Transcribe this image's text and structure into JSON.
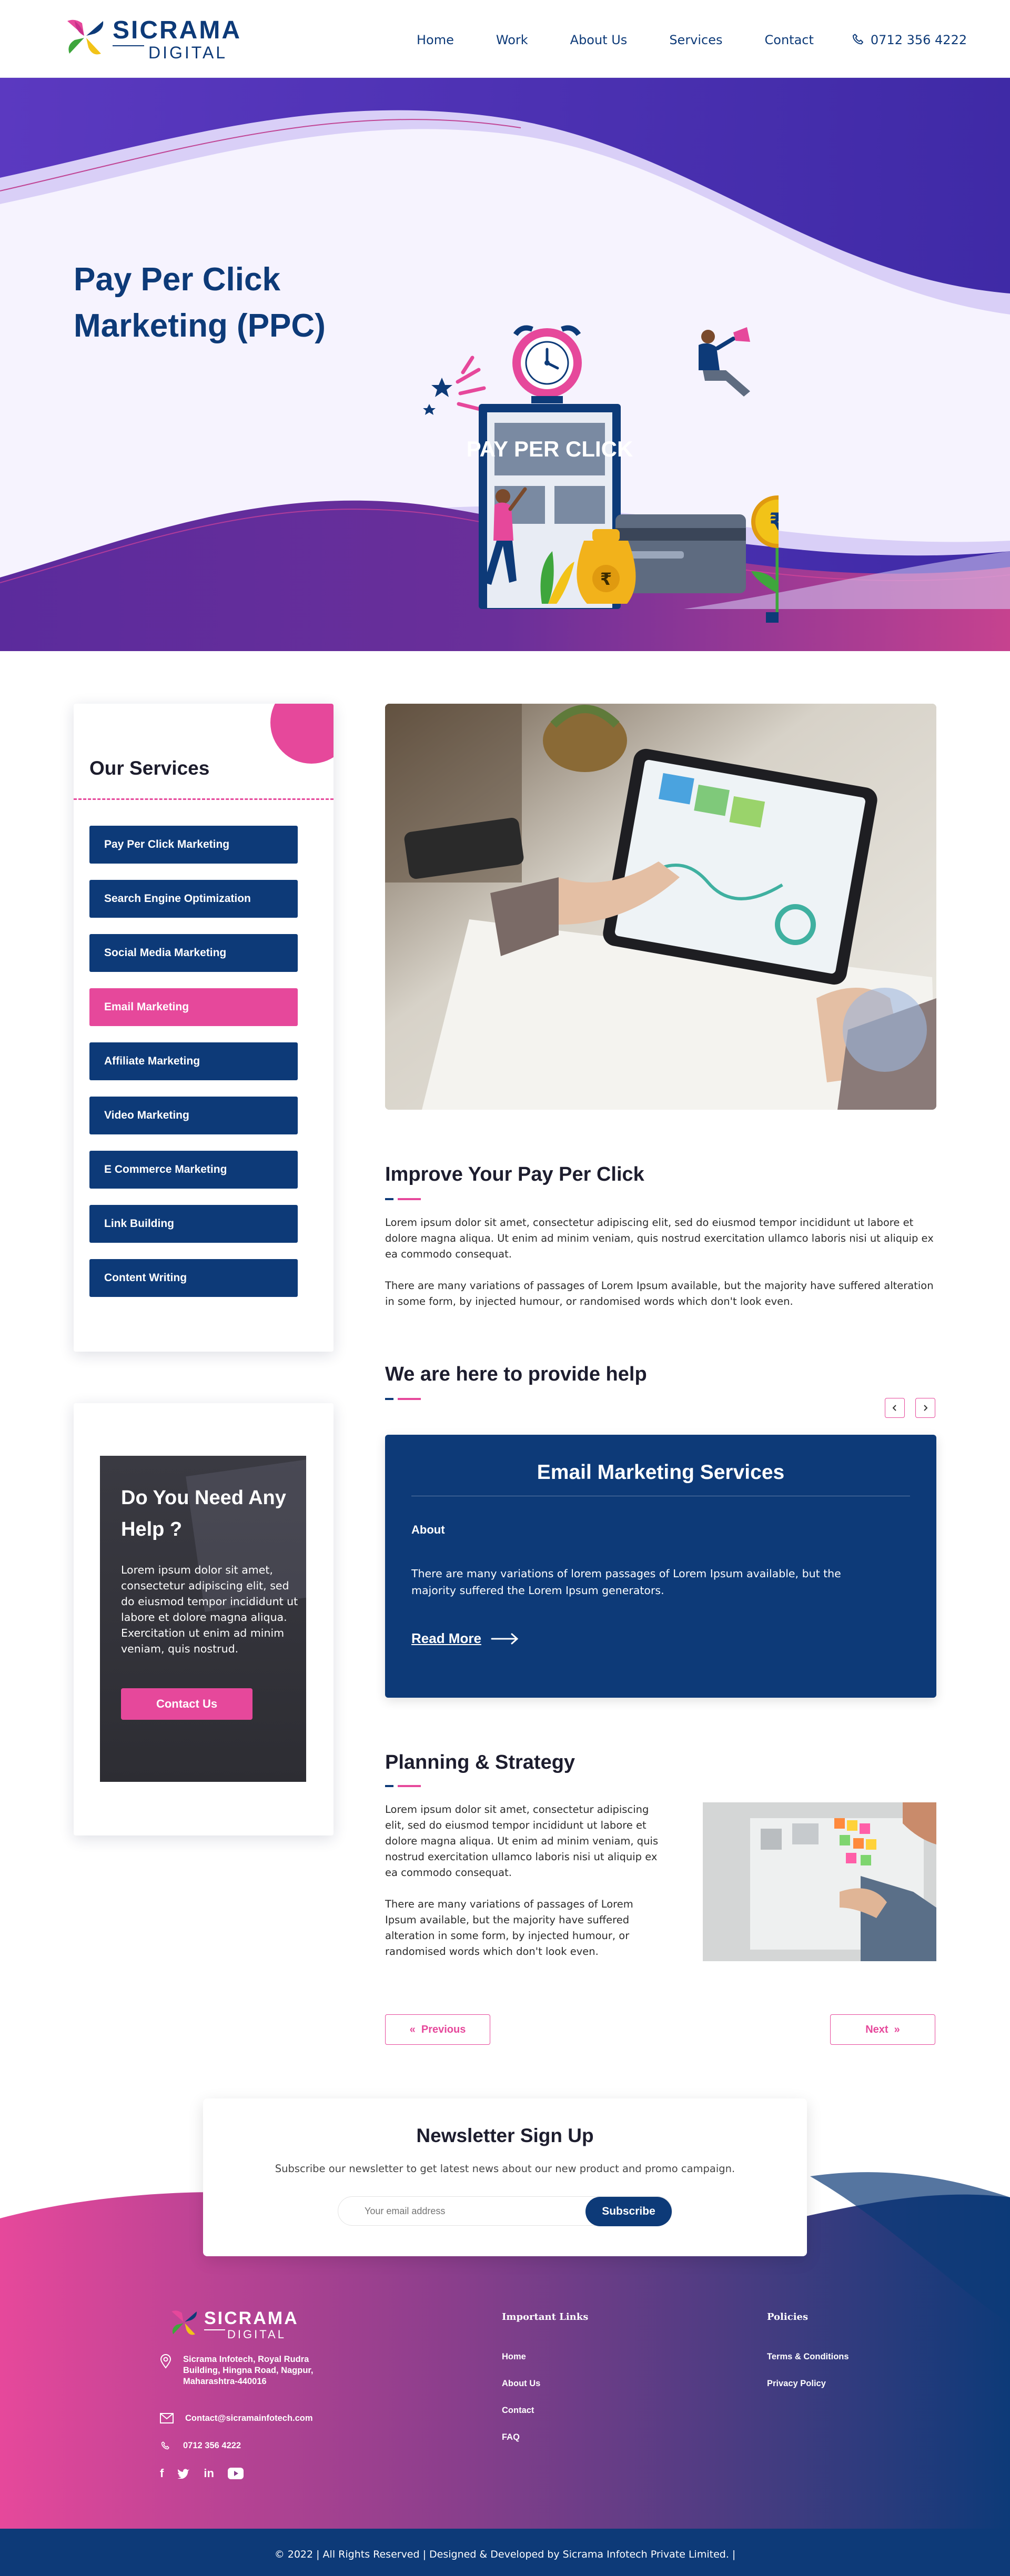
{
  "brand": {
    "name": "SICRAMA",
    "sub": "DIGITAL"
  },
  "nav": {
    "items": [
      {
        "label": "Home"
      },
      {
        "label": "Work"
      },
      {
        "label": "About Us"
      },
      {
        "label": "Services"
      },
      {
        "label": "Contact"
      }
    ],
    "phone": "0712 356 4222"
  },
  "hero": {
    "title": "Pay Per Click Marketing (PPC)",
    "illustration_text": "PAY PER CLICK",
    "currency_symbol": "₹"
  },
  "sidebar": {
    "title": "Our Services",
    "items": [
      {
        "label": "Pay Per Click Marketing",
        "active": false
      },
      {
        "label": "Search Engine Optimization",
        "active": false
      },
      {
        "label": "Social Media Marketing",
        "active": false
      },
      {
        "label": "Email Marketing",
        "active": true
      },
      {
        "label": "Affiliate Marketing",
        "active": false
      },
      {
        "label": "Video Marketing",
        "active": false
      },
      {
        "label": "E Commerce Marketing",
        "active": false
      },
      {
        "label": "Link Building",
        "active": false
      },
      {
        "label": "Content Writing",
        "active": false
      }
    ]
  },
  "help": {
    "title": "Do You Need Any Help ?",
    "text": "Lorem ipsum dolor sit amet, consectetur adipiscing elit, sed do eiusmod tempor incididunt ut labore et dolore magna aliqua. Exercitation ut enim ad minim veniam, quis nostrud.",
    "button": "Contact Us"
  },
  "improve": {
    "title": "Improve Your Pay Per Click",
    "p1": "Lorem ipsum dolor sit amet, consectetur adipiscing elit, sed do eiusmod tempor incididunt ut labore et dolore magna aliqua. Ut enim ad minim veniam, quis nostrud exercitation ullamco laboris nisi ut aliquip ex ea commodo consequat.",
    "p2": "There are many variations of passages of Lorem Ipsum available, but the majority have suffered alteration in some form, by injected humour, or randomised words which don't look even."
  },
  "help_section": {
    "title": "We are here to provide help",
    "prev_icon": "chevron-left-icon",
    "next_icon": "chevron-right-icon"
  },
  "email_card": {
    "title": "Email Marketing Services",
    "about_label": "About",
    "text": "There are many variations of lorem passages of Lorem Ipsum available, but the majority suffered the Lorem Ipsum generators.",
    "read_more": "Read More"
  },
  "planning": {
    "title": "Planning & Strategy",
    "p1": "Lorem ipsum dolor sit amet, consectetur adipiscing elit, sed do eiusmod tempor incididunt ut labore et dolore magna aliqua. Ut enim ad minim veniam, quis nostrud exercitation ullamco laboris nisi ut aliquip ex ea commodo consequat.",
    "p2": "There are many variations of passages of Lorem Ipsum available, but the majority have suffered alteration in some form, by injected humour, or randomised words which don't look even."
  },
  "pagination": {
    "previous": "Previous",
    "next": "Next"
  },
  "newsletter": {
    "title": "Newsletter Sign Up",
    "subtitle": "Subscribe our newsletter to get latest news about our new product and promo campaign.",
    "placeholder": "Your email address",
    "button": "Subscribe"
  },
  "footer": {
    "address": "Sicrama Infotech, Royal Rudra Building, Hingna Road, Nagpur, Maharashtra-440016",
    "email": "Contact@sicramainfotech.com",
    "phone": "0712 356 4222",
    "socials": [
      "f",
      "twitter",
      "in",
      "youtube"
    ],
    "important_links_title": "Important Links",
    "important_links": [
      "Home",
      "About Us",
      "Contact",
      "FAQ"
    ],
    "policies_title": "Policies",
    "policies": [
      "Terms & Conditions",
      "Privacy Policy"
    ],
    "copyright": "© 2022 | All Rights Reserved | Designed & Developed by Sicrama Infotech Private Limited. |"
  },
  "colors": {
    "navy": "#0d3a78",
    "pink": "#e6489b",
    "purple": "#4a2da8",
    "lavender": "#d7cdf6"
  }
}
